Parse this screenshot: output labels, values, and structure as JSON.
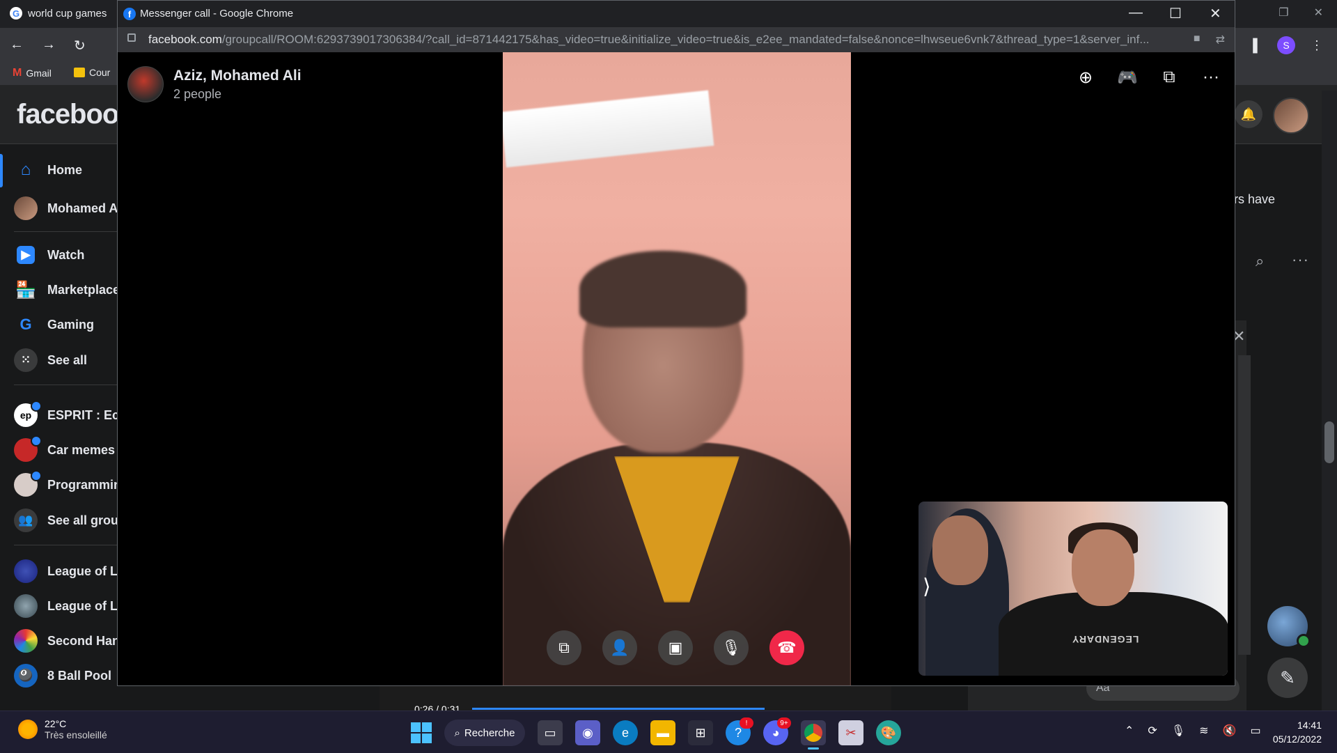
{
  "background_browser": {
    "tab_title": "world cup games",
    "bookmarks": [
      "Gmail",
      "Cour"
    ],
    "profile_letter": "S"
  },
  "facebook": {
    "logo": "facebook",
    "sidebar": {
      "items": [
        {
          "label": "Home",
          "icon": "home-icon",
          "color": "#2d88ff"
        },
        {
          "label": "Mohamed A",
          "icon": "avatar"
        },
        {
          "label": "Watch",
          "icon": "watch-icon",
          "color": "#2d88ff"
        },
        {
          "label": "Marketplace",
          "icon": "marketplace-icon",
          "color": "#2d88ff"
        },
        {
          "label": "Gaming",
          "icon": "gaming-icon",
          "color": "#2d88ff"
        },
        {
          "label": "See all",
          "icon": "grid-icon"
        }
      ],
      "groups": [
        {
          "label": "ESPRIT : Eco"
        },
        {
          "label": "Car memes "
        },
        {
          "label": "Programmin"
        },
        {
          "label": "See all grou"
        }
      ],
      "shortcuts": [
        {
          "label": "League of Le"
        },
        {
          "label": "League of Le"
        },
        {
          "label": "Second Han"
        },
        {
          "label": "8 Ball Pool"
        }
      ]
    },
    "right_snippet": "ers have",
    "chat_placeholder": "Aa"
  },
  "background_video": {
    "time": "0:26 / 0:31"
  },
  "call_window": {
    "window_title": "Messenger call - Google Chrome",
    "url_host": "facebook.com",
    "url_path": "/groupcall/ROOM:6293739017306384/?call_id=871442175&has_video=true&initialize_video=true&is_e2ee_mandated=false&nonce=lhwseue6vnk7&thread_type=1&server_inf...",
    "caller_name": "Aziz, Mohamed Ali",
    "caller_subtitle": "2 people",
    "self_view_shirt_text": "LEGENDARY",
    "top_actions": [
      "add-icon",
      "game-icon",
      "screen-share-icon",
      "more-icon"
    ],
    "controls": [
      "share-screen-icon",
      "add-person-icon",
      "camera-icon",
      "mic-icon",
      "end-call-icon"
    ]
  },
  "taskbar": {
    "temperature": "22°C",
    "condition": "Très ensoleillé",
    "search_label": "Recherche",
    "discord_badge": "9+",
    "help_badge": "!",
    "time": "14:41",
    "date": "05/12/2022"
  }
}
